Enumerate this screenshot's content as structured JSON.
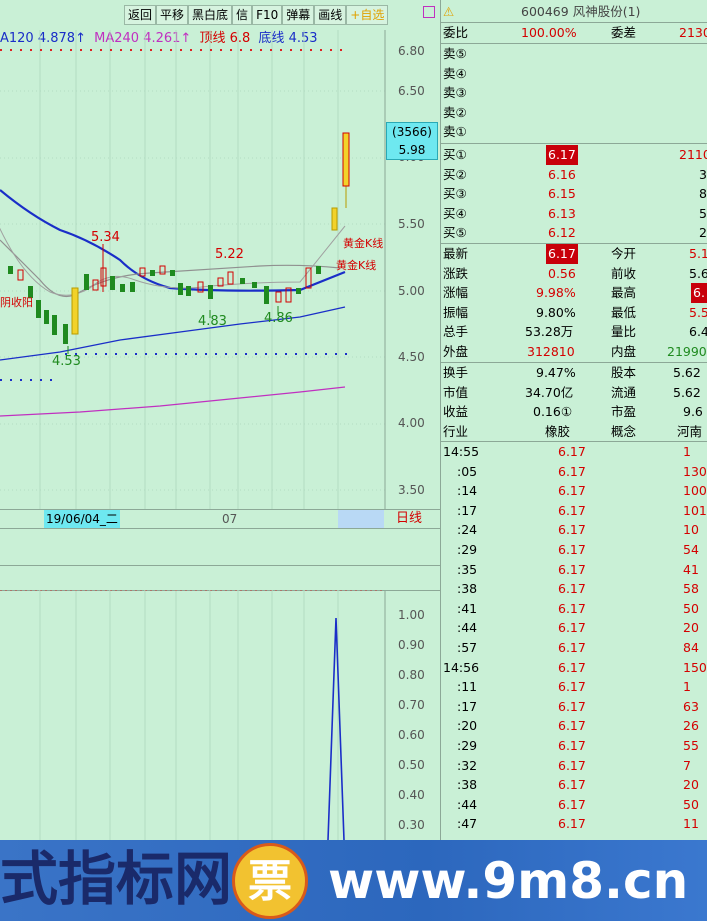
{
  "header": {
    "ma120_label": "A120",
    "ma120_value": "4.878↑",
    "ma240_label": "MA240",
    "ma240_value": "4.261↑",
    "top_line_label": "顶线",
    "top_line_value": "6.8",
    "bottom_line_label": "底线",
    "bottom_line_value": "4.53"
  },
  "toolbar": {
    "back": "返回",
    "pan": "平移",
    "bw": "黑白底",
    "info": "信",
    "f10": "F10",
    "danmu": "弹幕",
    "draw": "画线",
    "add_watch": "+自选"
  },
  "price_axis": [
    "6.80",
    "6.50",
    "6.00",
    "5.50",
    "5.00",
    "4.50",
    "4.00",
    "3.50"
  ],
  "price_tag": {
    "volume": "(3566)",
    "price": "5.98"
  },
  "annotations": {
    "high_534": "5.34",
    "high_522": "5.22",
    "low_483": "4.83",
    "low_486": "4.86",
    "low_453": "4.53",
    "golden_k1": "黄金K线",
    "golden_k2": "黄金K线",
    "yin_shou_yang": "阴收阳"
  },
  "date_bar": {
    "date": "19/06/04_二",
    "month": "07",
    "period": "日线"
  },
  "indicator_axis": [
    "1.00",
    "0.90",
    "0.80",
    "0.70",
    "0.60",
    "0.50",
    "0.40",
    "0.30"
  ],
  "quote": {
    "code_name": "600469 风神股份(1)",
    "weibi_label": "委比",
    "weibi_value": "100.00%",
    "weicha_label": "委差",
    "weicha_value": "2130",
    "asks": [
      {
        "label": "卖⑤"
      },
      {
        "label": "卖④"
      },
      {
        "label": "卖③"
      },
      {
        "label": "卖②"
      },
      {
        "label": "卖①"
      }
    ],
    "bids": [
      {
        "label": "买①",
        "price": "6.17",
        "vol": "2110"
      },
      {
        "label": "买②",
        "price": "6.16",
        "vol": "3"
      },
      {
        "label": "买③",
        "price": "6.15",
        "vol": "8"
      },
      {
        "label": "买④",
        "price": "6.13",
        "vol": "5"
      },
      {
        "label": "买⑤",
        "price": "6.12",
        "vol": "2"
      }
    ],
    "stats": [
      {
        "l1": "最新",
        "v1": "6.17",
        "l2": "今开",
        "v2": "5.1"
      },
      {
        "l1": "涨跌",
        "v1": "0.56",
        "l2": "前收",
        "v2": "5.6"
      },
      {
        "l1": "涨幅",
        "v1": "9.98%",
        "l2": "最高",
        "v2": "6."
      },
      {
        "l1": "振幅",
        "v1": "9.80%",
        "l2": "最低",
        "v2": "5.5"
      },
      {
        "l1": "总手",
        "v1": "53.28万",
        "l2": "量比",
        "v2": "6.4"
      },
      {
        "l1": "外盘",
        "v1": "312810",
        "l2": "内盘",
        "v2": "21990"
      }
    ],
    "fundamentals": [
      {
        "l1": "换手",
        "v1": "9.47%",
        "l2": "股本",
        "v2": "5.62"
      },
      {
        "l1": "市值",
        "v1": "34.70亿",
        "l2": "流通",
        "v2": "5.62"
      },
      {
        "l1": "收益",
        "v1": "0.16①",
        "l2": "市盈",
        "v2": "9.6"
      },
      {
        "l1": "行业",
        "v1": "橡胶",
        "l2": "概念",
        "v2": "河南"
      }
    ],
    "ticks": [
      {
        "t": "14:55",
        "p": "6.17",
        "v": "1"
      },
      {
        "t": ":05",
        "p": "6.17",
        "v": "130"
      },
      {
        "t": ":14",
        "p": "6.17",
        "v": "100"
      },
      {
        "t": ":17",
        "p": "6.17",
        "v": "101"
      },
      {
        "t": ":24",
        "p": "6.17",
        "v": "10"
      },
      {
        "t": ":29",
        "p": "6.17",
        "v": "54"
      },
      {
        "t": ":35",
        "p": "6.17",
        "v": "41"
      },
      {
        "t": ":38",
        "p": "6.17",
        "v": "58"
      },
      {
        "t": ":41",
        "p": "6.17",
        "v": "50"
      },
      {
        "t": ":44",
        "p": "6.17",
        "v": "20"
      },
      {
        "t": ":57",
        "p": "6.17",
        "v": "84"
      },
      {
        "t": "14:56",
        "p": "6.17",
        "v": "150"
      },
      {
        "t": ":11",
        "p": "6.17",
        "v": "1"
      },
      {
        "t": ":17",
        "p": "6.17",
        "v": "63"
      },
      {
        "t": ":20",
        "p": "6.17",
        "v": "26"
      },
      {
        "t": ":29",
        "p": "6.17",
        "v": "55"
      },
      {
        "t": ":32",
        "p": "6.17",
        "v": "7"
      },
      {
        "t": ":38",
        "p": "6.17",
        "v": "20"
      },
      {
        "t": ":44",
        "p": "6.17",
        "v": "50"
      },
      {
        "t": ":47",
        "p": "6.17",
        "v": "11"
      }
    ]
  },
  "banner": {
    "left_text": "式指标网",
    "right_text": "www.9m8.cn",
    "logo_char": "票"
  },
  "colors": {
    "bg": "#c9f0d6",
    "red": "#d40000",
    "green_candle": "#1f8a1f",
    "yellow_candle": "#f2d22a",
    "ma_blue": "#1a2ec8",
    "ma_magenta": "#c030c0",
    "banner": "#2f6cc2"
  }
}
